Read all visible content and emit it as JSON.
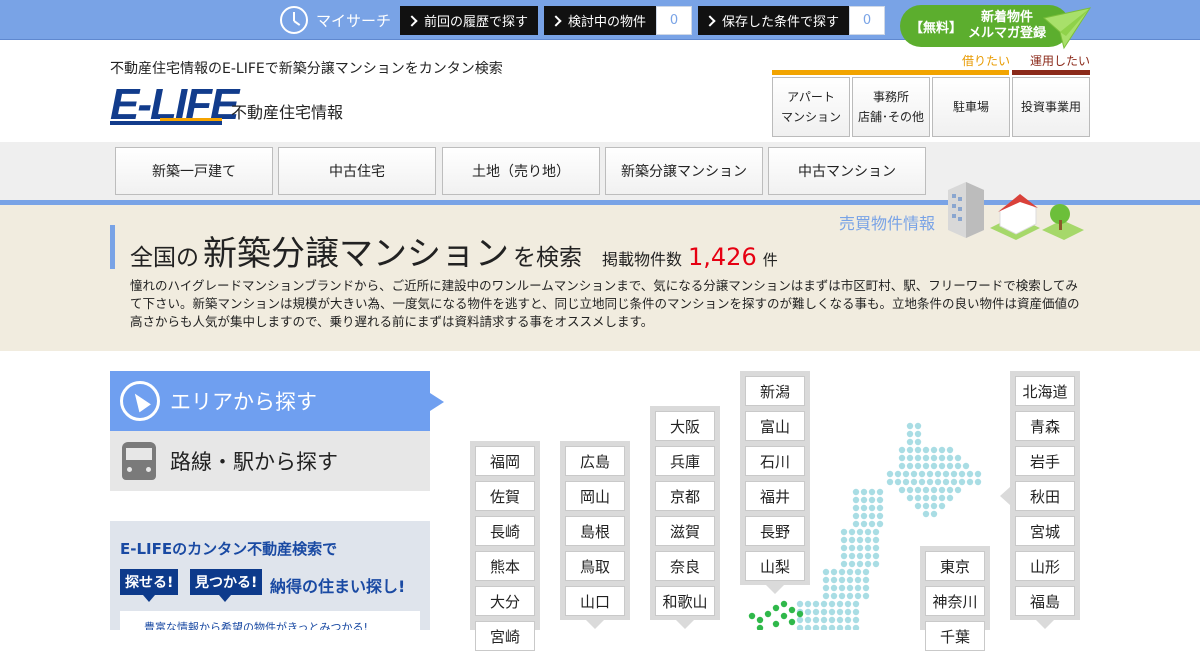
{
  "topbar": {
    "mysearch": "マイサーチ",
    "history": {
      "label": "前回の履歴で探す"
    },
    "considering": {
      "label": "検討中の物件",
      "count": "0"
    },
    "saved": {
      "label": "保存した条件で探す",
      "count": "0"
    },
    "magazine": {
      "free": "【無料】",
      "line1": "新着物件",
      "line2": "メルマガ登録"
    }
  },
  "header": {
    "tagline": "不動産住宅情報のE-LIFEで新築分譲マンションをカンタン検索",
    "logo": "E-LIFE",
    "logo_sub": "不動産住宅情報",
    "rent_label": "借りたい",
    "invest_label": "運用したい",
    "categories": [
      {
        "line1": "アパート",
        "line2": "マンション"
      },
      {
        "line1": "事務所",
        "line2": "店舗･その他"
      },
      {
        "line1": "駐車場",
        "line2": ""
      },
      {
        "line1": "投資事業用",
        "line2": ""
      }
    ]
  },
  "nav": [
    "新築一戸建て",
    "中古住宅",
    "土地（売り地）",
    "新築分譲マンション",
    "中古マンション"
  ],
  "hero": {
    "baibai": "売買物件情報",
    "title_prefix": "全国の",
    "title_main": "新築分譲マンション",
    "title_suffix": "を検索",
    "count_label": "掲載物件数",
    "count": "1,426",
    "count_unit": "件",
    "description": "憧れのハイグレードマンションブランドから、ご近所に建設中のワンルームマンションまで、気になる分譲マンションはまずは市区町村、駅、フリーワードで検索してみて下さい。新築マンションは規模が大きい為、一度気になる物件を逃すと、同じ立地同じ条件のマンションを探すのが難しくなる事も。立地条件の良い物件は資産価値の高さからも人気が集中しますので、乗り遅れる前にまずは資料請求する事をオススメします。"
  },
  "tabs": {
    "area": "エリアから探す",
    "line": "路線・駅から探す"
  },
  "promo": {
    "line1": "E-LIFEのカンタン不動産検索で",
    "tag1": "探せる!",
    "tag2": "見つかる!",
    "line2": "納得の住まい探し!",
    "note": "豊富な情報から希望の物件がきっとみつかる!"
  },
  "map": {
    "kyushu": [
      "福岡",
      "佐賀",
      "長崎",
      "熊本",
      "大分",
      "宮崎"
    ],
    "chugoku": [
      "広島",
      "岡山",
      "島根",
      "鳥取",
      "山口"
    ],
    "kinki": [
      "大阪",
      "兵庫",
      "京都",
      "滋賀",
      "奈良",
      "和歌山"
    ],
    "hokuriku": [
      "新潟",
      "富山",
      "石川",
      "福井",
      "長野",
      "山梨"
    ],
    "kanto": [
      "東京",
      "神奈川",
      "千葉"
    ],
    "tohoku": [
      "北海道",
      "青森",
      "岩手",
      "秋田",
      "宮城",
      "山形",
      "福島"
    ]
  },
  "colors": {
    "accent": "#79a3e6",
    "navy": "#123c8c",
    "red": "#e60012",
    "green": "#5cae2e",
    "orange": "#f2a400"
  }
}
